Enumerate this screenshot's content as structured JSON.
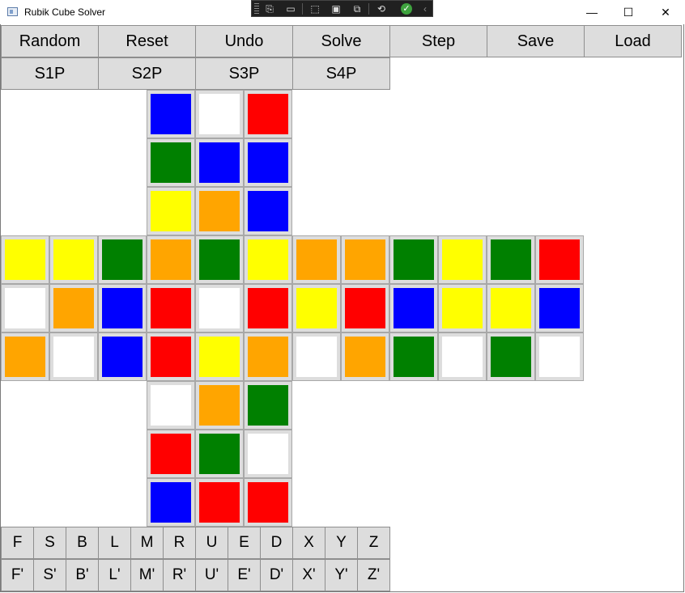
{
  "window": {
    "title": "Rubik Cube Solver",
    "controls": {
      "minimize": "—",
      "maximize": "☐",
      "close": "✕"
    }
  },
  "debug_toolbar": {
    "icons": [
      "select-element-icon",
      "record-icon",
      "pointer-icon",
      "layout-adorner-icon",
      "track-focus-icon",
      "hot-reload-icon",
      "status-ok-icon",
      "collapse-icon"
    ]
  },
  "toolbar": {
    "row1": [
      "Random",
      "Reset",
      "Undo",
      "Solve",
      "Step",
      "Save",
      "Load"
    ],
    "row2": [
      "S1P",
      "S2P",
      "S3P",
      "S4P"
    ]
  },
  "colors": {
    "B": "#0000ff",
    "W": "#ffffff",
    "R": "#ff0000",
    "G": "#008000",
    "Y": "#ffff00",
    "O": "#ffa500"
  },
  "faces": {
    "up": [
      [
        "B",
        "W",
        "R"
      ],
      [
        "G",
        "B",
        "B"
      ],
      [
        "Y",
        "O",
        "B"
      ]
    ],
    "left": [
      [
        "Y",
        "Y",
        "G"
      ],
      [
        "W",
        "O",
        "B"
      ],
      [
        "O",
        "W",
        "B"
      ]
    ],
    "front": [
      [
        "O",
        "G",
        "Y"
      ],
      [
        "R",
        "W",
        "R"
      ],
      [
        "R",
        "Y",
        "O"
      ]
    ],
    "right": [
      [
        "O",
        "O",
        "G"
      ],
      [
        "Y",
        "R",
        "B"
      ],
      [
        "W",
        "O",
        "G"
      ]
    ],
    "back": [
      [
        "Y",
        "G",
        "R"
      ],
      [
        "Y",
        "Y",
        "B"
      ],
      [
        "W",
        "G",
        "W"
      ]
    ],
    "down": [
      [
        "W",
        "O",
        "G"
      ],
      [
        "R",
        "G",
        "W"
      ],
      [
        "B",
        "R",
        "R"
      ]
    ]
  },
  "moves": {
    "row1": [
      "F",
      "S",
      "B",
      "L",
      "M",
      "R",
      "U",
      "E",
      "D",
      "X",
      "Y",
      "Z"
    ],
    "row2": [
      "F'",
      "S'",
      "B'",
      "L'",
      "M'",
      "R'",
      "U'",
      "E'",
      "D'",
      "X'",
      "Y'",
      "Z'"
    ]
  }
}
